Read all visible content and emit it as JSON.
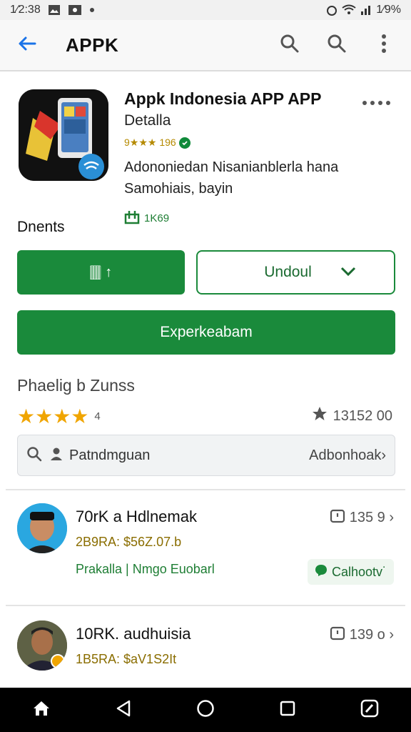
{
  "status_bar": {
    "time": "1⁄2:38",
    "battery": "1⁄9%"
  },
  "app_bar": {
    "title": "APPK"
  },
  "app": {
    "name": "Appk Indonesia APP APP",
    "subtitle": "Detalla",
    "rating_text": "9★★★ 196",
    "description_line1": "Adononiedan Nisanianblerla hana",
    "description_line2": "Samohiais, bayin",
    "downloads": "1K69"
  },
  "section_label": "Dnents",
  "buttons": {
    "primary_text": "🀫 ↑",
    "outline_label": "Undoul",
    "wide_label": "Experkeabam"
  },
  "reviews": {
    "title": "Phaelig b Zunss",
    "stars": "★★★★",
    "rating_value": "4",
    "count": "13152 00"
  },
  "search": {
    "placeholder": "Patndmguan",
    "right_label": "Adbonhoak›"
  },
  "items": [
    {
      "name": "70rK a Hdlnemak",
      "meta": "2B9RA: $56Z.07.b",
      "extra": "Prakalla | Nmgo Euobarl",
      "count": "135 9 ›",
      "chip": "Calhootv˙"
    },
    {
      "name": "10RK. audhuisia",
      "meta": "1B5RA: $aV1S2It",
      "count": "139 o ›"
    }
  ],
  "colors": {
    "accent": "#1a8a3b",
    "link": "#1a73e8",
    "star": "#f0a500"
  }
}
